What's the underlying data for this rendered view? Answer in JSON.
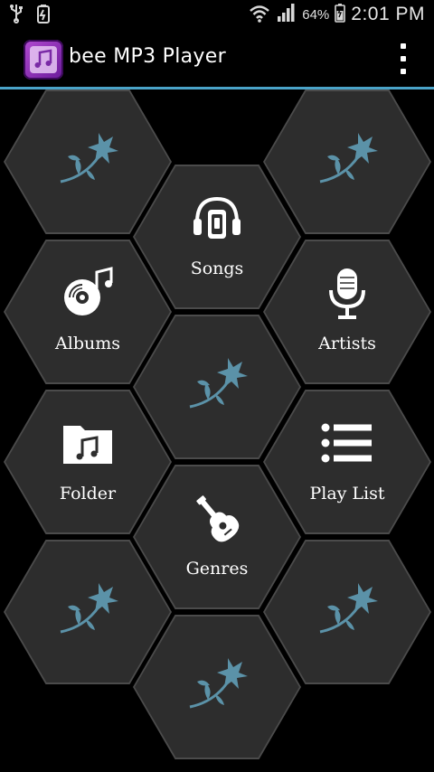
{
  "status_bar": {
    "battery_percent": "64%",
    "time": "2:01 PM",
    "icons": [
      "usb-icon",
      "battery-saver-icon",
      "wifi-icon",
      "signal-icon",
      "battery-icon"
    ]
  },
  "action_bar": {
    "title": "bee MP3 Player",
    "app_icon": "app-logo-icon",
    "menu_icon": "overflow-menu-icon"
  },
  "grid": {
    "songs": "Songs",
    "albums": "Albums",
    "artists": "Artists",
    "folder": "Folder",
    "playlist": "Play List",
    "genres": "Genres"
  },
  "colors": {
    "accent": "#4aa3c8",
    "hex_fill": "#2d2d2d",
    "hex_border": "#4b4b4b",
    "flower": "#5b92a8"
  }
}
